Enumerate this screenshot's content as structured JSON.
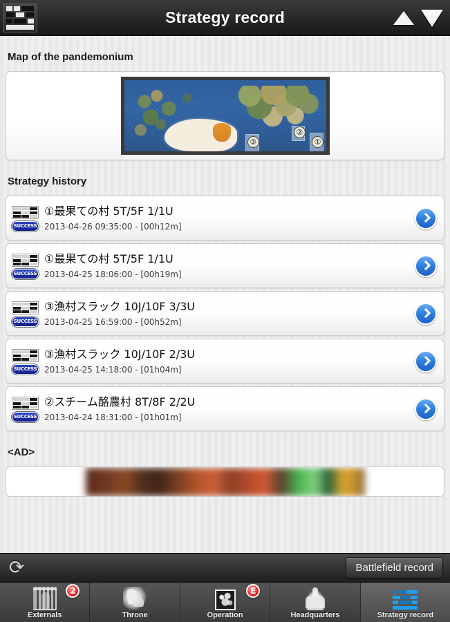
{
  "header": {
    "title": "Strategy record",
    "logo_icon": "schedule-grid-icon",
    "scroll_up_icon": "triangle-up-icon",
    "scroll_down_icon": "triangle-down-icon"
  },
  "map_section": {
    "title": "Map of the pandemonium",
    "markers": [
      {
        "label": "③"
      },
      {
        "label": "②"
      },
      {
        "label": "①"
      }
    ]
  },
  "history_section": {
    "title": "Strategy history",
    "items": [
      {
        "status": "SUCCESS",
        "title": "①最果ての村 5T/5F 1/1U",
        "subtitle": "2013-04-26 09:35:00 - [00h12m]",
        "chevron_icon": "chevron-right-icon"
      },
      {
        "status": "SUCCESS",
        "title": "①最果ての村 5T/5F 1/1U",
        "subtitle": "2013-04-25 18:06:00 - [00h19m]",
        "chevron_icon": "chevron-right-icon"
      },
      {
        "status": "SUCCESS",
        "title": "③漁村スラック 10J/10F 3/3U",
        "subtitle": "2013-04-25 16:59:00 - [00h52m]",
        "chevron_icon": "chevron-right-icon"
      },
      {
        "status": "SUCCESS",
        "title": "③漁村スラック 10J/10F 2/3U",
        "subtitle": "2013-04-25 14:18:00 - [01h04m]",
        "chevron_icon": "chevron-right-icon"
      },
      {
        "status": "SUCCESS",
        "title": "②スチーム酪農村 8T/8F 2/2U",
        "subtitle": "2013-04-24 18:31:00 - [01h01m]",
        "chevron_icon": "chevron-right-icon"
      }
    ]
  },
  "ad_section": {
    "title": "<AD>"
  },
  "toolbar": {
    "refresh_icon": "refresh-icon",
    "refresh_glyph": "⟳",
    "battlefield_label": "Battlefield record"
  },
  "tabbar": {
    "tabs": [
      {
        "label": "Externals",
        "icon": "gate-icon",
        "badge": "2",
        "active": false
      },
      {
        "label": "Throne",
        "icon": "throne-icon",
        "badge": "",
        "active": false
      },
      {
        "label": "Operation",
        "icon": "operation-map-icon",
        "badge": "E",
        "active": false
      },
      {
        "label": "Headquarters",
        "icon": "castle-icon",
        "badge": "",
        "active": false
      },
      {
        "label": "Strategy record",
        "icon": "schedule-grid-icon",
        "badge": "",
        "active": true
      }
    ]
  },
  "colors": {
    "accent_blue": "#2f7fe0",
    "badge_red": "#e01a1a",
    "success_blue": "#1b2fa6",
    "tab_icon_blue": "#1ea0f0",
    "page_bg": "#e9e9e9",
    "chrome_dark": "#2b2b2b"
  }
}
